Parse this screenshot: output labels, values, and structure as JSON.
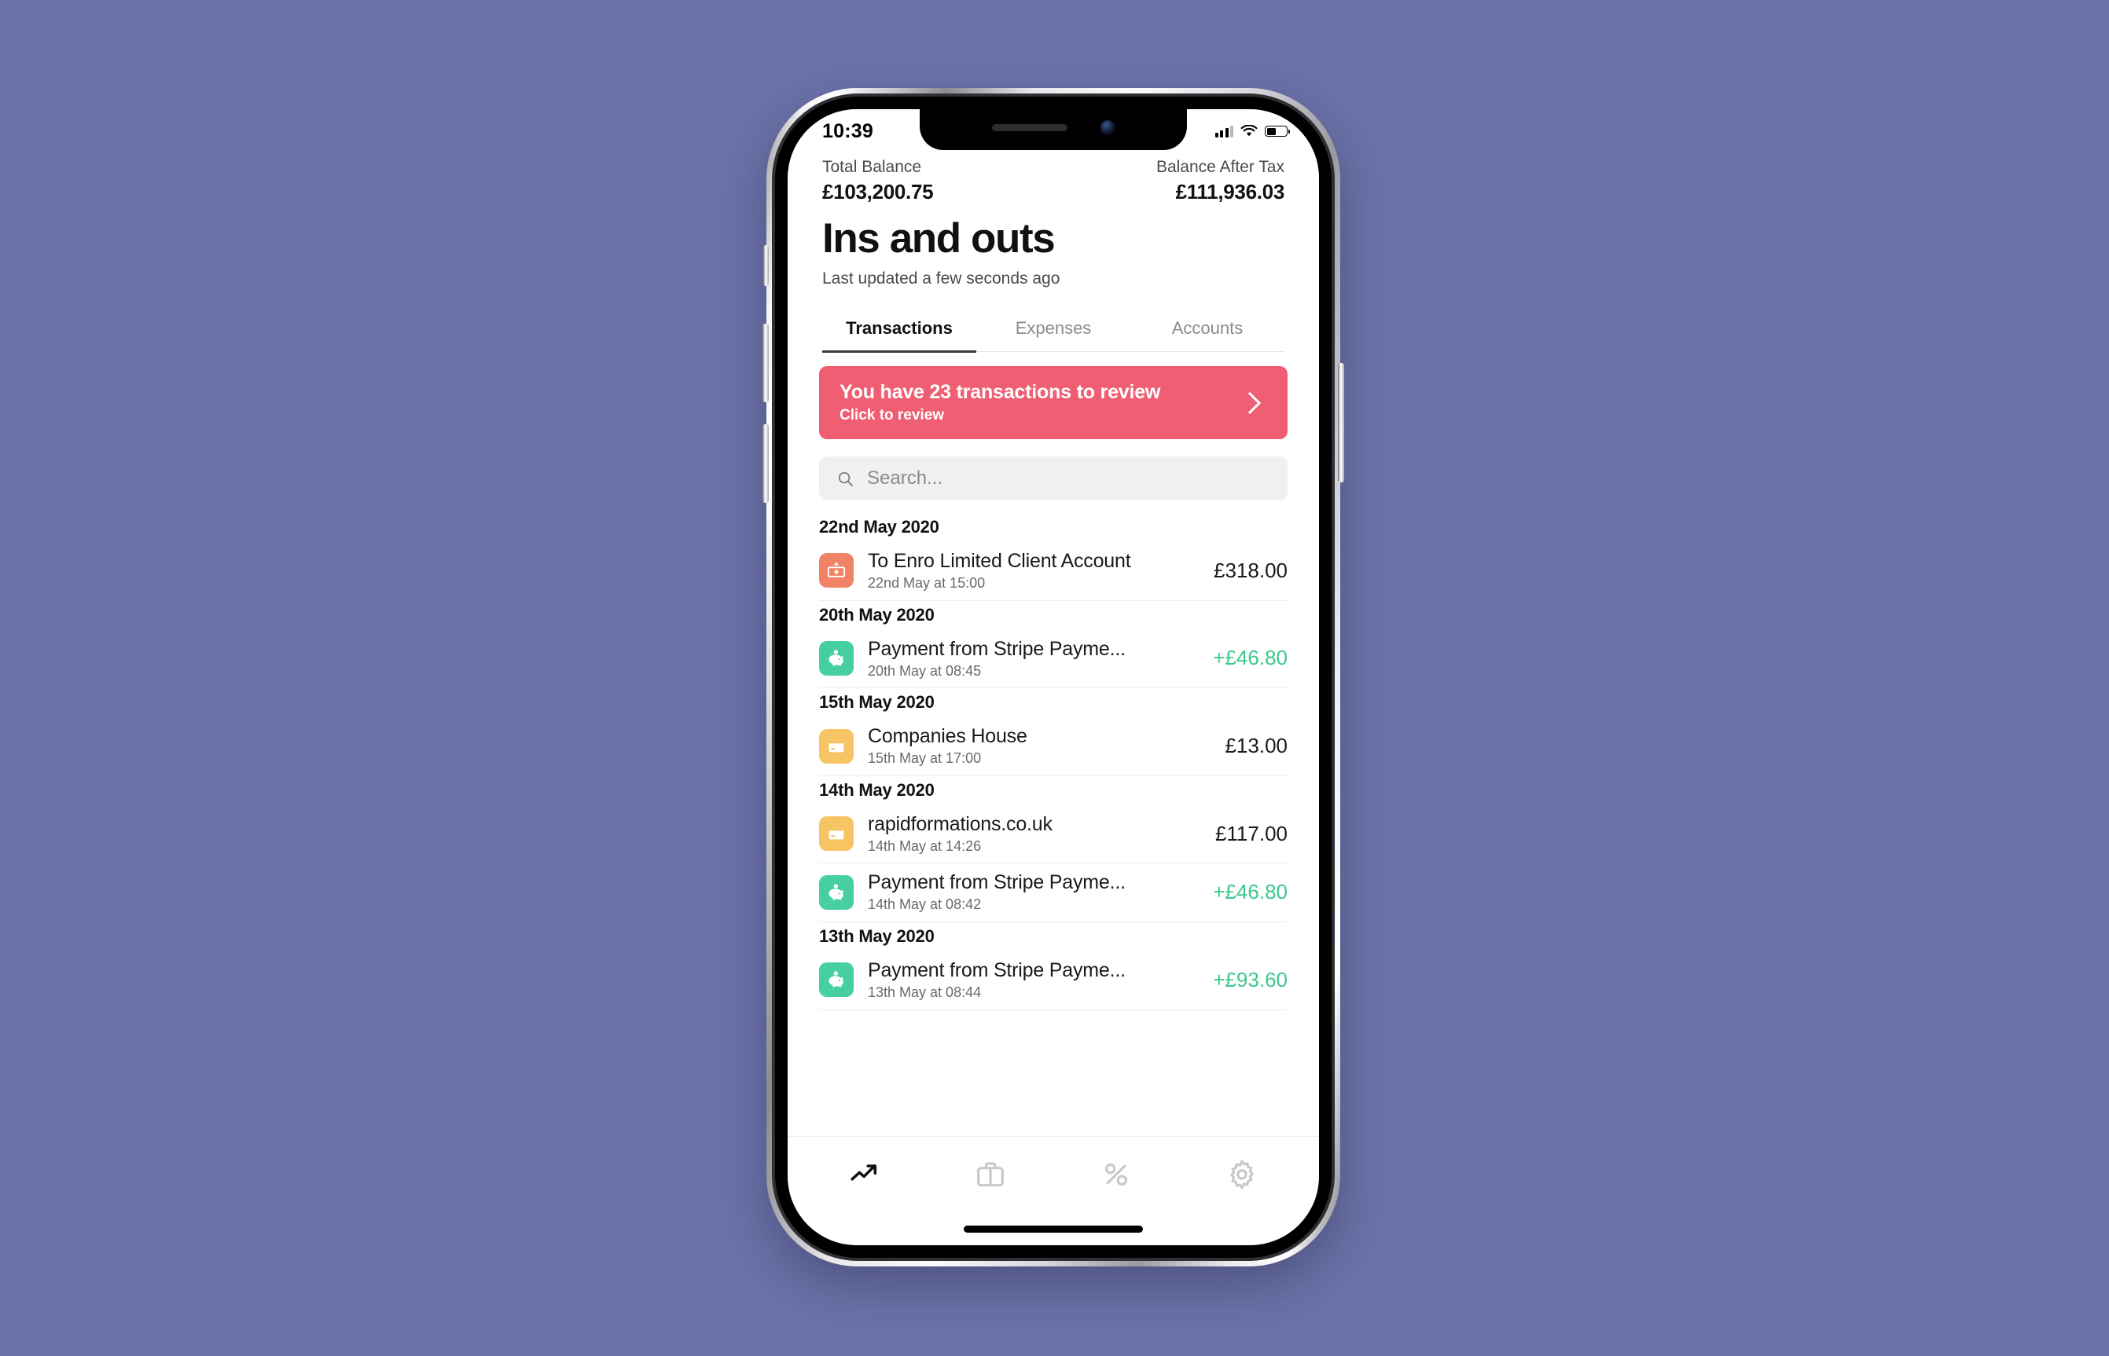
{
  "status_bar": {
    "time": "10:39",
    "signal_icon": "cellular-signal-icon",
    "wifi_icon": "wifi-icon",
    "battery_icon": "battery-icon"
  },
  "header": {
    "total_balance_label": "Total Balance",
    "total_balance_value": "£103,200.75",
    "after_tax_label": "Balance After Tax",
    "after_tax_value": "£111,936.03",
    "title": "Ins and outs",
    "subtitle": "Last updated a few seconds ago"
  },
  "tabs": [
    {
      "label": "Transactions",
      "active": true
    },
    {
      "label": "Expenses",
      "active": false
    },
    {
      "label": "Accounts",
      "active": false
    }
  ],
  "banner": {
    "title": "You have 23 transactions to review",
    "subtitle": "Click to review",
    "chevron_icon": "chevron-right-icon",
    "color": "#EF5E72"
  },
  "search": {
    "placeholder": "Search...",
    "value": "",
    "icon": "search-icon"
  },
  "colors": {
    "credit_green": "#3CC98B",
    "icon_coral": "#F08266",
    "icon_green": "#45CFA3",
    "icon_yellow": "#F7C464",
    "page_background": "#6B72A8"
  },
  "transaction_groups": [
    {
      "date": "22nd May 2020",
      "transactions": [
        {
          "name": "To Enro Limited Client Account",
          "time": "22nd May at 15:00",
          "amount": "£318.00",
          "credit": false,
          "icon": "banknote-transfer-icon",
          "icon_color": "#F08266"
        }
      ]
    },
    {
      "date": "20th May 2020",
      "transactions": [
        {
          "name": "Payment from Stripe Payme...",
          "time": "20th May at 08:45",
          "amount": "+£46.80",
          "credit": true,
          "icon": "piggy-bank-icon",
          "icon_color": "#45CFA3"
        }
      ]
    },
    {
      "date": "15th May 2020",
      "transactions": [
        {
          "name": "Companies House",
          "time": "15th May at 17:00",
          "amount": "£13.00",
          "credit": false,
          "icon": "card-icon",
          "icon_color": "#F7C464"
        }
      ]
    },
    {
      "date": "14th May 2020",
      "transactions": [
        {
          "name": "rapidformations.co.uk",
          "time": "14th May at 14:26",
          "amount": "£117.00",
          "credit": false,
          "icon": "card-icon",
          "icon_color": "#F7C464"
        },
        {
          "name": "Payment from Stripe Payme...",
          "time": "14th May at 08:42",
          "amount": "+£46.80",
          "credit": true,
          "icon": "piggy-bank-icon",
          "icon_color": "#45CFA3"
        }
      ]
    },
    {
      "date": "13th May 2020",
      "transactions": [
        {
          "name": "Payment from Stripe Payme...",
          "time": "13th May at 08:44",
          "amount": "+£93.60",
          "credit": true,
          "icon": "piggy-bank-icon",
          "icon_color": "#45CFA3"
        }
      ]
    }
  ],
  "bottom_tabs": [
    {
      "icon": "trending-up-icon",
      "active": true
    },
    {
      "icon": "briefcase-icon",
      "active": false
    },
    {
      "icon": "percent-icon",
      "active": false
    },
    {
      "icon": "gear-icon",
      "active": false
    }
  ]
}
